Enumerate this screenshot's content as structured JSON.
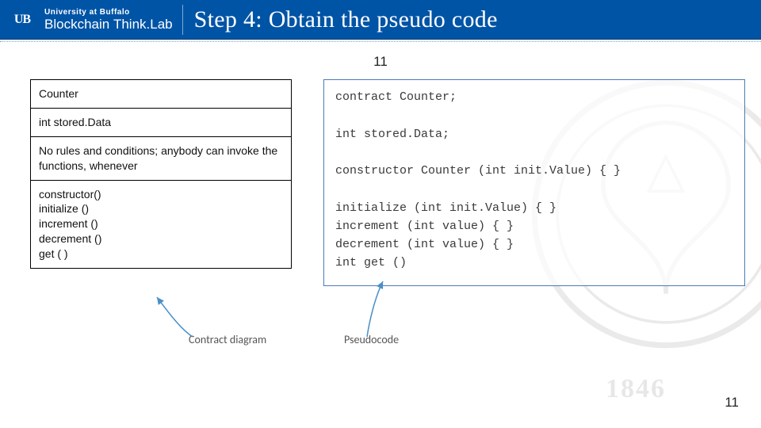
{
  "header": {
    "ub_mark": "UB",
    "logo_top": "University at Buffalo",
    "logo_bottom_strong": "Blockchain",
    "logo_bottom_thin": "Think.Lab",
    "title": "Step 4: Obtain the pseudo code"
  },
  "slide_number_top": "11",
  "diagram": {
    "rows": [
      "Counter",
      "int stored.Data",
      "No rules and conditions; anybody can invoke the functions, whenever",
      "constructor()\ninitialize ()\nincrement ()\ndecrement ()\nget ( )"
    ]
  },
  "pseudocode": "contract Counter;\n\nint stored.Data;\n\nconstructor Counter (int init.Value) { }\n\ninitialize (int init.Value) { }\nincrement (int value) { }\ndecrement (int value) { }\nint get ()",
  "captions": {
    "diagram": "Contract diagram",
    "pseudo": "Pseudocode"
  },
  "watermark_year": "1846",
  "page_number_bottom": "11"
}
